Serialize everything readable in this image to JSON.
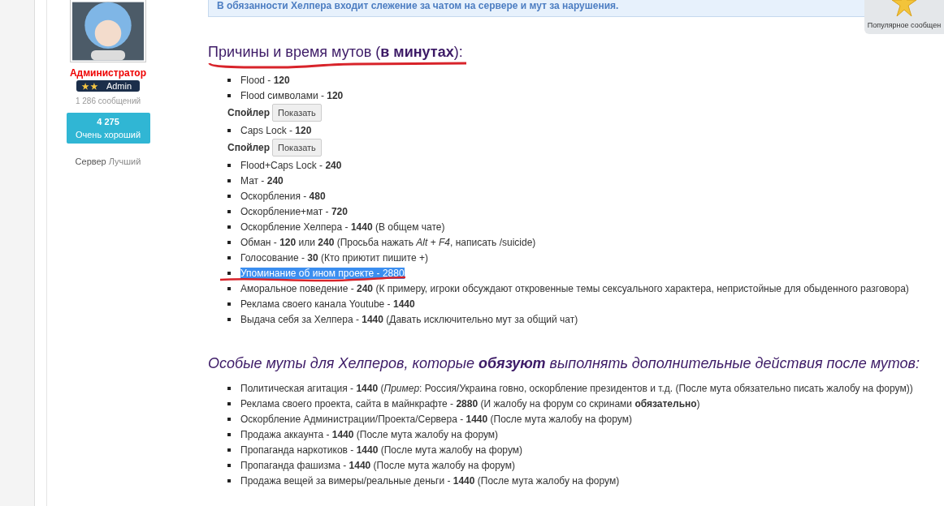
{
  "user": {
    "role": "Администратор",
    "badge": {
      "label": "Admin"
    },
    "messages": "1 286 сообщений",
    "rating": {
      "value": "4 275",
      "label": "Очень хороший"
    },
    "server_label": "Сервер",
    "server_value": "Лучший"
  },
  "notice": "В обязанности Хелпера входит слежение за чатом на сервере и мут за нарушения.",
  "popular_badge": "Популярное сообщен",
  "section1": {
    "heading": "Причины и время мутов (**в минутах**):",
    "underlined": true,
    "items": [
      {
        "kind": "item",
        "text": "Flood - **120**",
        "highlighted": false,
        "underlined": false
      },
      {
        "kind": "item",
        "text": "Flood символами - **120**",
        "highlighted": false,
        "underlined": false
      },
      {
        "kind": "spoiler",
        "label": "Спойлер",
        "button": "Показать"
      },
      {
        "kind": "item",
        "text": "Caps Lock - **120**",
        "highlighted": false,
        "underlined": false
      },
      {
        "kind": "spoiler",
        "label": "Спойлер",
        "button": "Показать"
      },
      {
        "kind": "item",
        "text": "Flood+Caps Lock - **240**",
        "highlighted": false,
        "underlined": false
      },
      {
        "kind": "item",
        "text": "Мат - **240**",
        "highlighted": false,
        "underlined": false
      },
      {
        "kind": "item",
        "text": "Оскорбления - **480**",
        "highlighted": false,
        "underlined": false
      },
      {
        "kind": "item",
        "text": "Оскорбление+мат - **720**",
        "highlighted": false,
        "underlined": false
      },
      {
        "kind": "item",
        "text": "Оскорбление Хелпера - **1440** (В общем чате)",
        "highlighted": false,
        "underlined": false
      },
      {
        "kind": "item",
        "text": "Обман - **120** или **240** (Просьба нажать *Alt* + *F4*, написать /suicide)",
        "highlighted": false,
        "underlined": false
      },
      {
        "kind": "item",
        "text": "Голосование - **30** (Кто приютит пишите +)",
        "highlighted": false,
        "underlined": false
      },
      {
        "kind": "item",
        "text": "Упоминание об ином проекте - 2880",
        "highlighted": true,
        "underlined": true
      },
      {
        "kind": "item",
        "text": "Аморальное поведение - **240** (К примеру, игроки обсуждают откровенные темы сексуального характера, непристойные для обыденного разговора)",
        "highlighted": false,
        "underlined": false
      },
      {
        "kind": "item",
        "text": "Реклама своего канала Youtube - **1440**",
        "highlighted": false,
        "underlined": false
      },
      {
        "kind": "item",
        "text": "Выдача себя за Хелпера - **1440** (Давать исключительно мут за общий чат)",
        "highlighted": false,
        "underlined": false
      }
    ]
  },
  "section2": {
    "heading": "Особые муты для Хелперов, которые **обязуют** выполнять дополнительные действия после мутов:",
    "items": [
      "Политическая агитация - **1440** (*Пример*: Россия/Украина говно, оскорбление президентов и т.д. (После мута обязательно писать жалобу на форум))",
      "Реклама своего проекта, сайта в майнкрафте - **2880** (И жалобу на форум со скринами **обязательно**)",
      "Оскорбление Администрации/Проекта/Сервера - **1440** (После мута жалобу на форум)",
      "Продажа аккаунта - **1440** (После мута жалобу на форум)",
      "Пропаганда наркотиков - **1440** (После мута жалобу на форум)",
      "Пропаганда фашизма - **1440** (После мута жалобу на форум)",
      "Продажа вещей за вимеры/реальные деньги - **1440** (После мута жалобу на форум)"
    ]
  }
}
